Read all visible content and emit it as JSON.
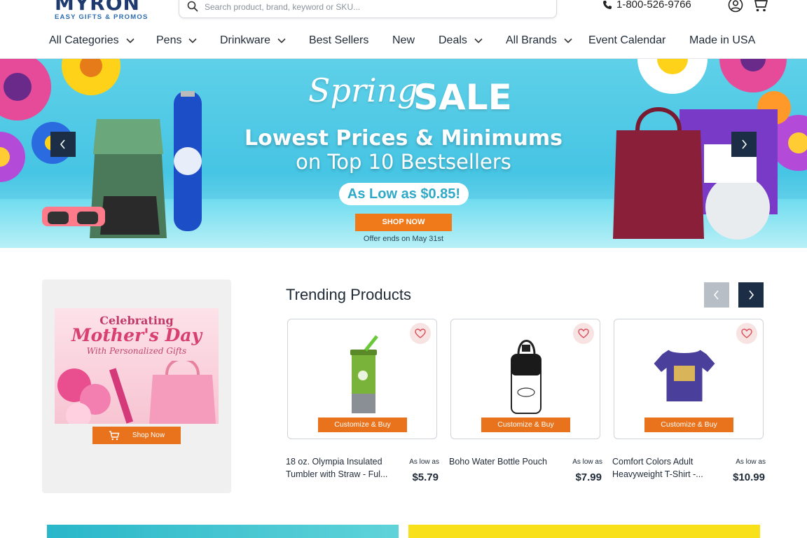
{
  "header": {
    "logo_brand": "MYRON",
    "logo_tagline": "EASY GIFTS & PROMOS",
    "search_placeholder": "Search product, brand, keyword or SKU...",
    "phone": "1-800-526-9766"
  },
  "nav": {
    "items": [
      {
        "label": "All Categories",
        "has_dropdown": true
      },
      {
        "label": "Pens",
        "has_dropdown": true
      },
      {
        "label": "Drinkware",
        "has_dropdown": true
      },
      {
        "label": "Best Sellers",
        "has_dropdown": false
      },
      {
        "label": "New",
        "has_dropdown": false
      },
      {
        "label": "Deals",
        "has_dropdown": true
      },
      {
        "label": "All Brands",
        "has_dropdown": true
      },
      {
        "label": "Event Calendar",
        "has_dropdown": false
      },
      {
        "label": "Made in USA",
        "has_dropdown": false
      }
    ]
  },
  "hero": {
    "script_title": "Spring",
    "sale_title": "SALE",
    "headline_1": "Lowest Prices & Minimums",
    "headline_2": "on Top 10 Bestsellers",
    "price_pill": "As Low as $0.85!",
    "cta": "SHOP NOW",
    "offer": "Offer ends on May 31st"
  },
  "promo": {
    "line1": "Celebrating",
    "line2": "Mother's Day",
    "line3": "With Personalized Gifts",
    "button": "Shop Now"
  },
  "trending": {
    "title": "Trending Products",
    "products": [
      {
        "name_l1": "18 oz. Olympia Insulated",
        "name_l2": "Tumbler with Straw - Ful...",
        "as_low_as": "As low as",
        "price": "$5.79",
        "cta": "Customize & Buy"
      },
      {
        "name_l1": "Boho Water Bottle Pouch",
        "name_l2": "",
        "as_low_as": "As low as",
        "price": "$7.99",
        "cta": "Customize & Buy"
      },
      {
        "name_l1": "Comfort Colors Adult",
        "name_l2": "Heavyweight T-Shirt -...",
        "as_low_as": "As low as",
        "price": "$10.99",
        "cta": "Customize & Buy"
      }
    ]
  },
  "colors": {
    "accent_orange": "#e8731c",
    "navy": "#1c2e45",
    "hero_sky": "#46c5e4"
  }
}
